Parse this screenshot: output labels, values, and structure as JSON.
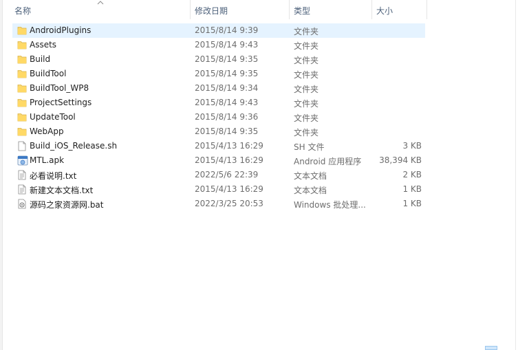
{
  "columns": {
    "name": "名称",
    "date": "修改日期",
    "type": "类型",
    "size": "大小"
  },
  "files": [
    {
      "icon": "folder-icon",
      "name": "AndroidPlugins",
      "date": "2015/8/14 9:39",
      "type": "文件夹",
      "size": ""
    },
    {
      "icon": "folder-icon",
      "name": "Assets",
      "date": "2015/8/14 9:43",
      "type": "文件夹",
      "size": ""
    },
    {
      "icon": "folder-icon",
      "name": "Build",
      "date": "2015/8/14 9:35",
      "type": "文件夹",
      "size": ""
    },
    {
      "icon": "folder-icon",
      "name": "BuildTool",
      "date": "2015/8/14 9:35",
      "type": "文件夹",
      "size": ""
    },
    {
      "icon": "folder-icon",
      "name": "BuildTool_WP8",
      "date": "2015/8/14 9:34",
      "type": "文件夹",
      "size": ""
    },
    {
      "icon": "folder-icon",
      "name": "ProjectSettings",
      "date": "2015/8/14 9:43",
      "type": "文件夹",
      "size": ""
    },
    {
      "icon": "folder-icon",
      "name": "UpdateTool",
      "date": "2015/8/14 9:36",
      "type": "文件夹",
      "size": ""
    },
    {
      "icon": "folder-icon",
      "name": "WebApp",
      "date": "2015/8/14 9:35",
      "type": "文件夹",
      "size": ""
    },
    {
      "icon": "file-icon",
      "name": "Build_iOS_Release.sh",
      "date": "2015/4/13 16:29",
      "type": "SH 文件",
      "size": "3 KB"
    },
    {
      "icon": "apk-icon",
      "name": "MTL.apk",
      "date": "2015/4/13 16:29",
      "type": "Android 应用程序",
      "size": "38,394 KB"
    },
    {
      "icon": "text-file-icon",
      "name": "必看说明.txt",
      "date": "2022/5/6 22:39",
      "type": "文本文档",
      "size": "2 KB"
    },
    {
      "icon": "text-file-icon",
      "name": "新建文本文档.txt",
      "date": "2015/4/13 16:29",
      "type": "文本文档",
      "size": "1 KB"
    },
    {
      "icon": "batch-file-icon",
      "name": "源码之家资源网.bat",
      "date": "2022/3/25 20:53",
      "type": "Windows 批处理...",
      "size": "1 KB"
    }
  ],
  "selected_index": 0,
  "colors": {
    "folder": "#f8d775",
    "selection": "#e5f3ff",
    "header_text": "#4c607a"
  }
}
